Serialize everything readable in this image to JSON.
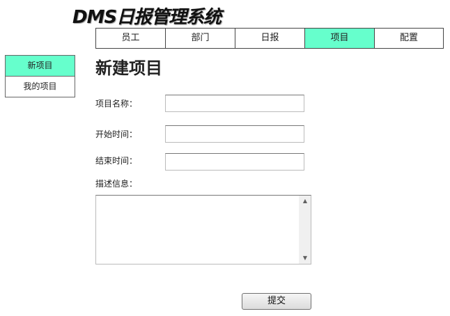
{
  "app": {
    "title": "DMS日报管理系统"
  },
  "top_nav": {
    "items": [
      {
        "label": "员工"
      },
      {
        "label": "部门"
      },
      {
        "label": "日报"
      },
      {
        "label": "项目",
        "active": true
      },
      {
        "label": "配置"
      }
    ]
  },
  "side_nav": {
    "items": [
      {
        "label": "新项目",
        "active": true
      },
      {
        "label": "我的项目"
      }
    ]
  },
  "page": {
    "title": "新建项目"
  },
  "form": {
    "project_name": {
      "label": "项目名称：",
      "value": ""
    },
    "start_time": {
      "label": "开始时间：",
      "value": ""
    },
    "end_time": {
      "label": "结束时间：",
      "value": ""
    },
    "description": {
      "label": "描述信息：",
      "value": ""
    },
    "submit_label": "提交"
  },
  "colors": {
    "active_nav": "#66ffcc",
    "border": "#444444"
  },
  "icons": {
    "scroll_up": "triangle-up-icon",
    "scroll_down": "triangle-down-icon"
  }
}
